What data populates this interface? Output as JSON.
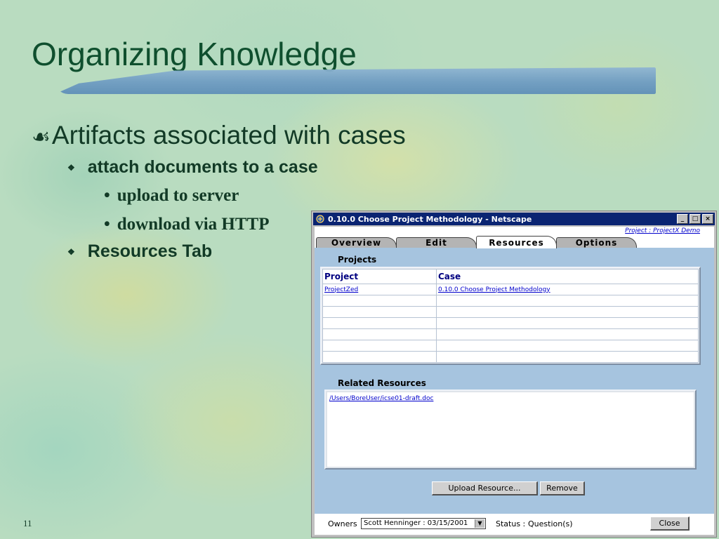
{
  "slide": {
    "title": "Organizing Knowledge",
    "bullet1": "Artifacts associated with cases",
    "bullet1_mark": "☙",
    "sub1": "attach documents to a case",
    "sub1_items": [
      "upload to server",
      "download via HTTP"
    ],
    "sub2": "Resources Tab",
    "sub_mark": "❖",
    "item_mark": "•",
    "page_number": "11",
    "colors": {
      "title": "#0f4f2e",
      "accent_bar": "#6f9cc2"
    }
  },
  "window": {
    "title": "0.10.0 Choose Project Methodology - Netscape",
    "icon": "netscape-icon",
    "controls": {
      "minimize": "_",
      "maximize": "□",
      "close": "×"
    },
    "project_link": "Project : ProjectX Demo",
    "tabs": [
      {
        "label": "Overview"
      },
      {
        "label": "Edit"
      },
      {
        "label": "Resources"
      },
      {
        "label": "Options"
      }
    ],
    "active_tab": "Resources",
    "projects": {
      "label": "Projects",
      "columns": [
        "Project",
        "Case"
      ],
      "rows": [
        [
          "ProjectZed",
          "0.10.0 Choose Project Methodology"
        ]
      ]
    },
    "related": {
      "label": "Related Resources",
      "items": [
        "/Users/BoreUser/icse01-draft.doc"
      ]
    },
    "buttons": {
      "upload": "Upload Resource...",
      "remove": "Remove",
      "close": "Close"
    },
    "footer": {
      "owners_label": "Owners",
      "owners_value": "Scott Henninger : 03/15/2001",
      "status_label": "Status :",
      "status_value": "Question(s)"
    }
  }
}
